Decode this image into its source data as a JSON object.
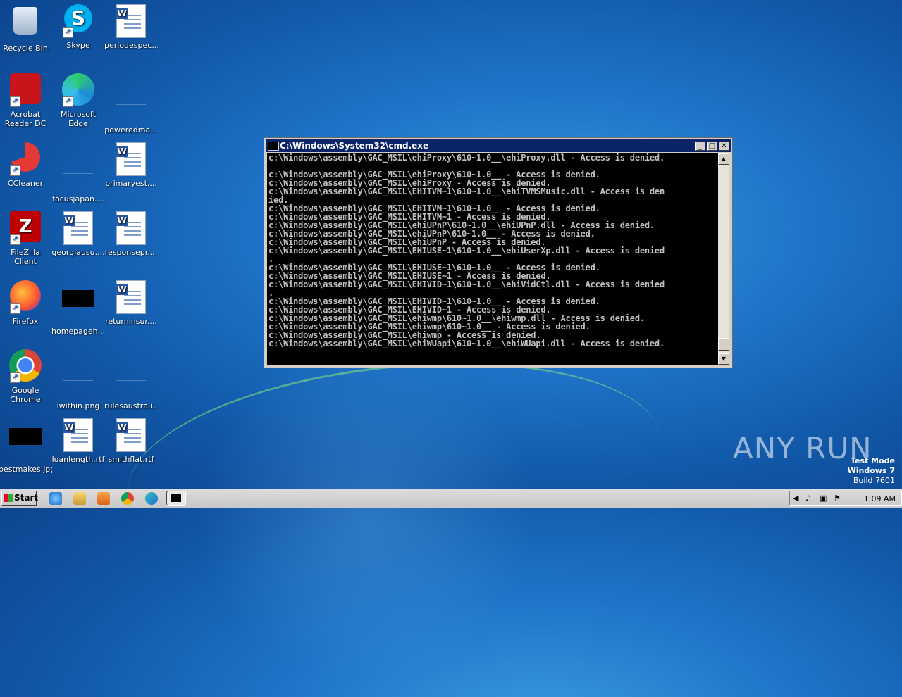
{
  "desktop": {
    "icons": [
      {
        "label": "Recycle Bin",
        "icon": "recycle-bin-icon"
      },
      {
        "label": "Skype",
        "icon": "skype-icon"
      },
      {
        "label": "periodespec...",
        "icon": "word-file-icon"
      },
      {
        "label": "Acrobat Reader DC",
        "icon": "acrobat-icon"
      },
      {
        "label": "Microsoft Edge",
        "icon": "edge-icon"
      },
      {
        "label": "poweredma...",
        "icon": "blank-file-icon"
      },
      {
        "label": "CCleaner",
        "icon": "ccleaner-icon"
      },
      {
        "label": "focusjapan....",
        "icon": "blank-file-icon"
      },
      {
        "label": "primaryest....",
        "icon": "word-file-icon"
      },
      {
        "label": "FileZilla Client",
        "icon": "filezilla-icon"
      },
      {
        "label": "georgiausu....",
        "icon": "word-file-icon"
      },
      {
        "label": "responsepr....",
        "icon": "word-file-icon"
      },
      {
        "label": "Firefox",
        "icon": "firefox-icon"
      },
      {
        "label": "homepageh....",
        "icon": "black-image-icon"
      },
      {
        "label": "returninsur....",
        "icon": "word-file-icon"
      },
      {
        "label": "Google Chrome",
        "icon": "chrome-icon"
      },
      {
        "label": "iwithin.png",
        "icon": "blank-file-icon"
      },
      {
        "label": "rulesaustrali....",
        "icon": "blank-file-icon"
      },
      {
        "label": "bestmakes.jpg",
        "icon": "black-image-icon"
      },
      {
        "label": "loanlength.rtf",
        "icon": "word-file-icon"
      },
      {
        "label": "smithflat.rtf",
        "icon": "word-file-icon"
      }
    ]
  },
  "cmd_window": {
    "title": "C:\\Windows\\System32\\cmd.exe",
    "lines": [
      "c:\\Windows\\assembly\\GAC_MSIL\\ehiProxy\\610~1.0__\\ehiProxy.dll - Access is denied.",
      "",
      "c:\\Windows\\assembly\\GAC_MSIL\\ehiProxy\\610~1.0__ - Access is denied.",
      "c:\\Windows\\assembly\\GAC_MSIL\\ehiProxy - Access is denied.",
      "c:\\Windows\\assembly\\GAC_MSIL\\EHITVM~1\\610~1.0__\\ehiTVMSMusic.dll - Access is den",
      "ied.",
      "c:\\Windows\\assembly\\GAC_MSIL\\EHITVM~1\\610~1.0__ - Access is denied.",
      "c:\\Windows\\assembly\\GAC_MSIL\\EHITVM~1 - Access is denied.",
      "c:\\Windows\\assembly\\GAC_MSIL\\ehiUPnP\\610~1.0__\\ehiUPnP.dll - Access is denied.",
      "c:\\Windows\\assembly\\GAC_MSIL\\ehiUPnP\\610~1.0__ - Access is denied.",
      "c:\\Windows\\assembly\\GAC_MSIL\\ehiUPnP - Access is denied.",
      "c:\\Windows\\assembly\\GAC_MSIL\\EHIUSE~1\\610~1.0__\\ehiUserXp.dll - Access is denied",
      ".",
      "c:\\Windows\\assembly\\GAC_MSIL\\EHIUSE~1\\610~1.0__ - Access is denied.",
      "c:\\Windows\\assembly\\GAC_MSIL\\EHIUSE~1 - Access is denied.",
      "c:\\Windows\\assembly\\GAC_MSIL\\EHIVID~1\\610~1.0__\\ehiVidCtl.dll - Access is denied",
      ".",
      "c:\\Windows\\assembly\\GAC_MSIL\\EHIVID~1\\610~1.0__ - Access is denied.",
      "c:\\Windows\\assembly\\GAC_MSIL\\EHIVID~1 - Access is denied.",
      "c:\\Windows\\assembly\\GAC_MSIL\\ehiwmp\\610~1.0__\\ehiwmp.dll - Access is denied.",
      "c:\\Windows\\assembly\\GAC_MSIL\\ehiwmp\\610~1.0__ - Access is denied.",
      "c:\\Windows\\assembly\\GAC_MSIL\\ehiwmp - Access is denied.",
      "c:\\Windows\\assembly\\GAC_MSIL\\ehiWUapi\\610~1.0__\\ehiWUapi.dll - Access is denied."
    ]
  },
  "taskbar": {
    "start_label": "Start",
    "clock": "1:09 AM"
  },
  "watermark": {
    "brand": "ANY RUN",
    "line1": "Test Mode",
    "line2": "Windows 7",
    "line3": "Build 7601"
  }
}
